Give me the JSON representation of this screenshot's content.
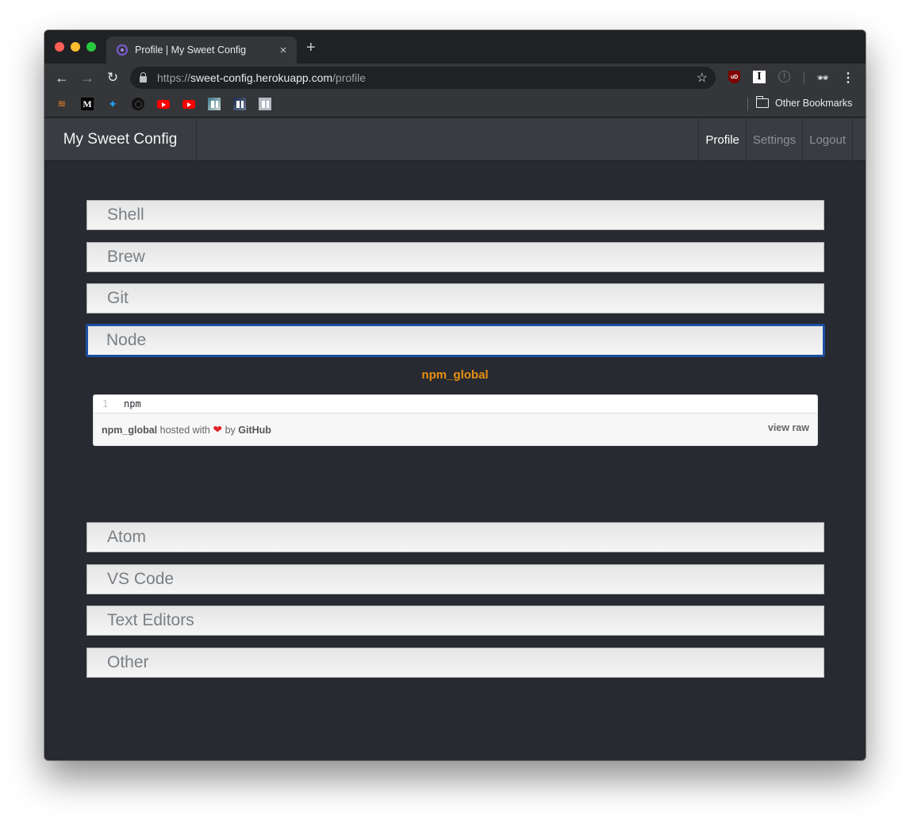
{
  "browser": {
    "tab": {
      "title": "Profile | My Sweet Config",
      "close_label": "×"
    },
    "new_tab_label": "+",
    "url": {
      "scheme": "https://",
      "host": "sweet-config.herokuapp.com",
      "path": "/profile"
    },
    "nav": {
      "back": "←",
      "forward": "→",
      "reload": "↻"
    },
    "star_label": "☆",
    "extensions": [
      {
        "name": "ublock-origin",
        "label": "uD"
      },
      {
        "name": "instapaper",
        "label": "I"
      },
      {
        "name": "info",
        "label": "!"
      },
      {
        "name": "incognito",
        "label": "🕶"
      },
      {
        "name": "menu",
        "label": "⋮"
      }
    ],
    "bookmarks": [
      {
        "name": "stack-overflow"
      },
      {
        "name": "medium",
        "label": "M"
      },
      {
        "name": "twitter",
        "label": "🐦"
      },
      {
        "name": "github"
      },
      {
        "name": "youtube"
      },
      {
        "name": "youtube"
      },
      {
        "name": "trello"
      },
      {
        "name": "trello"
      },
      {
        "name": "trello"
      }
    ],
    "other_bookmarks_label": "Other Bookmarks"
  },
  "app": {
    "brand": "My Sweet Config",
    "nav_links": [
      {
        "label": "Profile",
        "active": true
      },
      {
        "label": "Settings",
        "active": false
      },
      {
        "label": "Logout",
        "active": false
      }
    ]
  },
  "sections": [
    {
      "label": "Shell"
    },
    {
      "label": "Brew"
    },
    {
      "label": "Git"
    },
    {
      "label": "Node",
      "focused": true
    },
    {
      "label": "Atom"
    },
    {
      "label": "VS Code"
    },
    {
      "label": "Text Editors"
    },
    {
      "label": "Other"
    }
  ],
  "gist": {
    "title": "npm_global",
    "lines": [
      {
        "number": "1",
        "code": "npm"
      }
    ],
    "footer": {
      "file_name": "npm_global",
      "hosted_with": "hosted with",
      "heart": "❤",
      "by": "by",
      "host": "GitHub",
      "view_raw": "view raw"
    }
  },
  "colors": {
    "page_bg": "#272a30",
    "navbar_bg": "#393c41",
    "focus_border": "#1c4fa3",
    "gist_title": "#e88f13"
  }
}
